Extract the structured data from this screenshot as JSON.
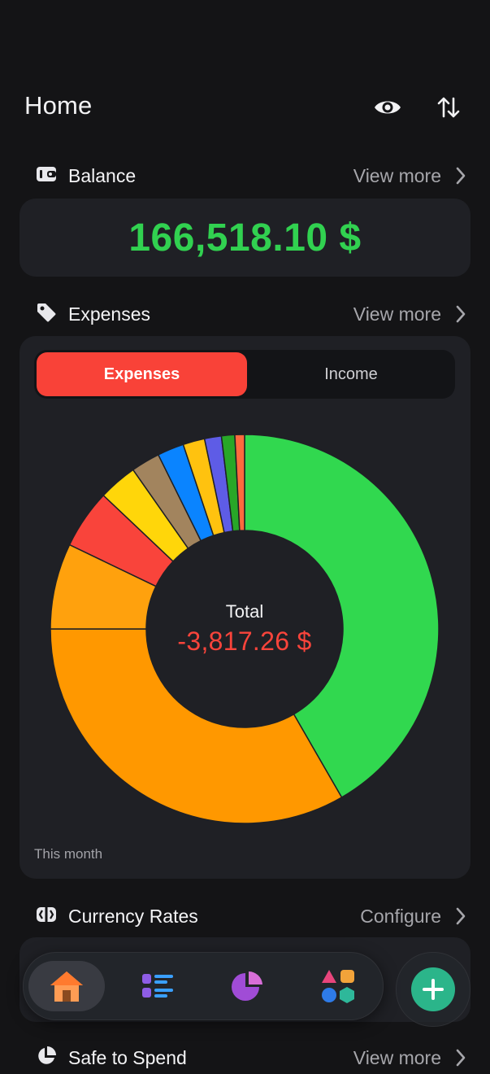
{
  "header": {
    "title": "Home",
    "icons": [
      "eye-icon",
      "sort-arrows-icon"
    ]
  },
  "balance": {
    "label": "Balance",
    "more_label": "View more",
    "value": "166,518.10 $",
    "value_color": "#31d150"
  },
  "expenses": {
    "label": "Expenses",
    "more_label": "View more",
    "tabs": {
      "active": "Expenses",
      "inactive": "Income"
    },
    "total_label": "Total",
    "total_value": "-3,817.26 $",
    "period": "This month"
  },
  "chart_data": {
    "type": "pie",
    "values": [
      41.5,
      33.2,
      7.1,
      4.9,
      3.2,
      2.4,
      2.2,
      1.8,
      1.4,
      1.1,
      0.8
    ],
    "colors": [
      "#31d84f",
      "#ff9800",
      "#ffa10d",
      "#f9443b",
      "#ffd60a",
      "#a2845e",
      "#0a84ff",
      "#ffc20f",
      "#5e5ce6",
      "#28a728",
      "#ff6a3d"
    ]
  },
  "currency": {
    "label": "Currency Rates",
    "more_label": "Configure"
  },
  "safe": {
    "label": "Safe to Spend",
    "more_label": "View more"
  },
  "nav": {
    "items": [
      "home-icon",
      "list-icon",
      "pie-chart-icon",
      "shapes-icon"
    ],
    "fab": "plus-icon"
  }
}
